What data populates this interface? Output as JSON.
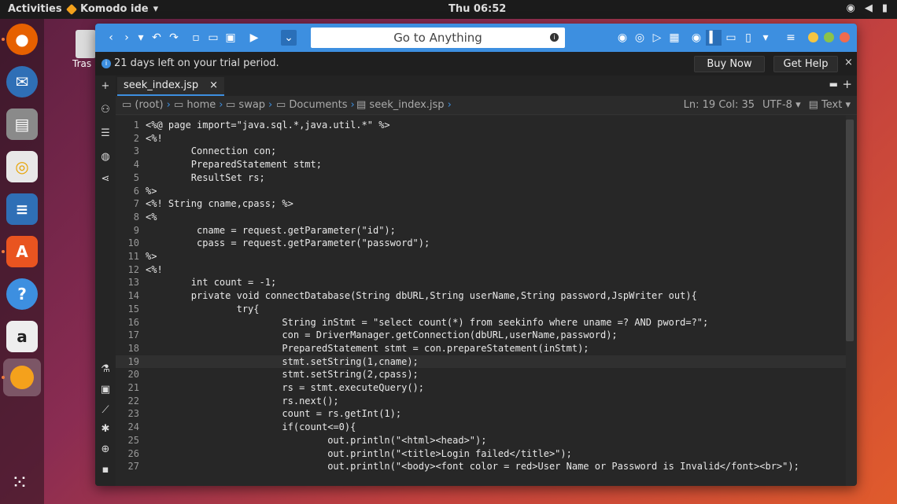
{
  "topbar": {
    "activities": "Activities",
    "app_name": "Komodo ide",
    "clock": "Thu 06:52"
  },
  "desktop": {
    "trash_label": "Tras"
  },
  "toolbar": {
    "goto_placeholder": "Go to Anything",
    "colors": {
      "accent": "#3d8fe0"
    }
  },
  "trial": {
    "message": "21 days left on your trial period.",
    "buy_now": "Buy Now",
    "get_help": "Get Help",
    "close": "×"
  },
  "tab": {
    "label": "seek_index.jsp",
    "close": "×"
  },
  "breadcrumbs": [
    "(root)",
    "home",
    "swap",
    "Documents",
    "seek_index.jsp"
  ],
  "status": {
    "position": "Ln: 19 Col: 35",
    "encoding": "UTF-8",
    "language": "Text"
  },
  "code_lines": [
    {
      "n": "1",
      "text": "<%@ page import=\"java.sql.*,java.util.*\" %>"
    },
    {
      "n": "2",
      "text": "<%!"
    },
    {
      "n": "3",
      "text": "        Connection con;"
    },
    {
      "n": "4",
      "text": "        PreparedStatement stmt;"
    },
    {
      "n": "5",
      "text": "        ResultSet rs;"
    },
    {
      "n": "6",
      "text": "%>"
    },
    {
      "n": "7",
      "text": "<%! String cname,cpass; %>"
    },
    {
      "n": "8",
      "text": "<%"
    },
    {
      "n": "9",
      "text": "         cname = request.getParameter(\"id\");"
    },
    {
      "n": "10",
      "text": "         cpass = request.getParameter(\"password\");"
    },
    {
      "n": "11",
      "text": "%>"
    },
    {
      "n": "12",
      "text": "<%!"
    },
    {
      "n": "13",
      "text": "        int count = -1;"
    },
    {
      "n": "14",
      "text": "        private void connectDatabase(String dbURL,String userName,String password,JspWriter out){"
    },
    {
      "n": "15",
      "text": "                try{"
    },
    {
      "n": "16",
      "text": "                        String inStmt = \"select count(*) from seekinfo where uname =? AND pword=?\";"
    },
    {
      "n": "17",
      "text": "                        con = DriverManager.getConnection(dbURL,userName,password);"
    },
    {
      "n": "18",
      "text": "                        PreparedStatement stmt = con.prepareStatement(inStmt);"
    },
    {
      "n": "19",
      "text": "                        stmt.setString(1,cname);"
    },
    {
      "n": "20",
      "text": "                        stmt.setString(2,cpass);"
    },
    {
      "n": "21",
      "text": "                        rs = stmt.executeQuery();"
    },
    {
      "n": "22",
      "text": "                        rs.next();"
    },
    {
      "n": "23",
      "text": "                        count = rs.getInt(1);"
    },
    {
      "n": "24",
      "text": "                        if(count<=0){"
    },
    {
      "n": "25",
      "text": "                                out.println(\"<html><head>\");"
    },
    {
      "n": "26",
      "text": "                                out.println(\"<title>Login failed</title>\");"
    },
    {
      "n": "27",
      "text": "                                out.println(\"<body><font color = red>User Name or Password is Invalid</font><br>\");"
    }
  ]
}
